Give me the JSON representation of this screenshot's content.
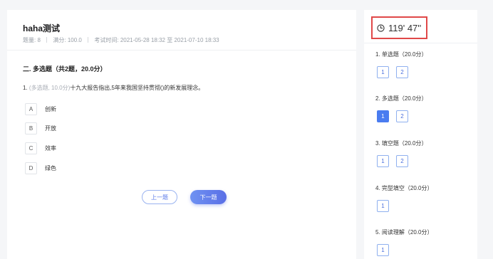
{
  "exam": {
    "title": "haha测试",
    "count_label": "题量:",
    "count": "8",
    "score_label": "满分:",
    "score": "100.0",
    "time_label": "考试时间:",
    "start": "2021-05-28 18:32",
    "to": "至",
    "end": "2021-07-10 18:33"
  },
  "section": {
    "title": "二. 多选题（共2题，20.0分）"
  },
  "question": {
    "number": "1.",
    "tag": "(多选题, 10.0分)",
    "text": "十九大报告指出,5年来我国坚持贯彻()的新发展理念。",
    "options": [
      {
        "letter": "A",
        "text": "创新"
      },
      {
        "letter": "B",
        "text": "开放"
      },
      {
        "letter": "C",
        "text": "效率"
      },
      {
        "letter": "D",
        "text": "绿色"
      }
    ]
  },
  "nav": {
    "prev": "上一题",
    "next": "下一题"
  },
  "timer": {
    "text": "119' 47''",
    "border_color": "#e04848"
  },
  "sidebar": {
    "groups": [
      {
        "title": "1. 单选题（20.0分）",
        "buttons": [
          "1",
          "2"
        ]
      },
      {
        "title": "2. 多选题（20.0分）",
        "buttons": [
          "1",
          "2"
        ]
      },
      {
        "title": "3. 填空题（20.0分）",
        "buttons": [
          "1",
          "2"
        ]
      },
      {
        "title": "4. 完型填空（20.0分）",
        "buttons": [
          "1"
        ]
      },
      {
        "title": "5. 阅读理解（20.0分）",
        "buttons": [
          "1"
        ]
      }
    ],
    "active": "2. 多选题 · 1"
  },
  "colors": {
    "accent": "#4a7cf0",
    "timer_border": "#e04848"
  }
}
